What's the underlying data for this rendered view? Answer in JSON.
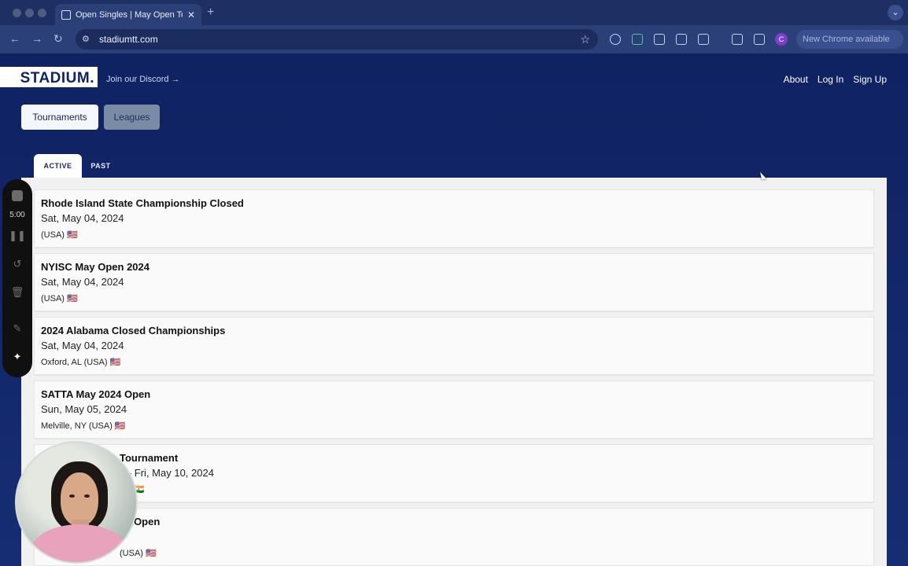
{
  "browser": {
    "tab": {
      "title": "Open Singles | May Open Tournament"
    },
    "address": "stadiumtt.com",
    "update_button": "New Chrome available",
    "profile_initial": "C",
    "icons": [
      "back-icon",
      "forward-icon",
      "reload-icon",
      "site-info-icon",
      "bookmark-star-icon",
      "extensions-icon",
      "side-panel-icon",
      "menu-icon"
    ]
  },
  "site": {
    "logo": "STADIUM.",
    "discord_link": "Join our Discord →",
    "nav": [
      "About",
      "Log In",
      "Sign Up"
    ],
    "segments": [
      "Tournaments",
      "Leagues"
    ],
    "subtabs": [
      "ACTIVE",
      "PAST"
    ],
    "tournaments": [
      {
        "name": "Rhode Island State Championship Closed",
        "date": "Sat, May 04, 2024",
        "location": "(USA) 🇺🇸"
      },
      {
        "name": "NYISC May Open 2024",
        "date": "Sat, May 04, 2024",
        "location": "(USA) 🇺🇸"
      },
      {
        "name": "2024 Alabama Closed Championships",
        "date": "Sat, May 04, 2024",
        "location": "Oxford, AL (USA) 🇺🇸"
      },
      {
        "name": "SATTA May 2024 Open",
        "date": "Sun, May 05, 2024",
        "location": "Melville, NY (USA) 🇺🇸"
      },
      {
        "name": "Tournament",
        "date": "4 - Fri, May 10, 2024",
        "location": "ID) 🇮🇳"
      },
      {
        "name": "24 Open",
        "date": "4",
        "location": "(USA) 🇺🇸"
      }
    ]
  },
  "recorder": {
    "timer": "5:00",
    "colors": {
      "bar": "#101010",
      "accent": "#f2f2f2"
    }
  },
  "colors": {
    "page_bg": "#0f2262",
    "card_bg": "#fafafa",
    "segment_active": "#f4f7fc"
  }
}
